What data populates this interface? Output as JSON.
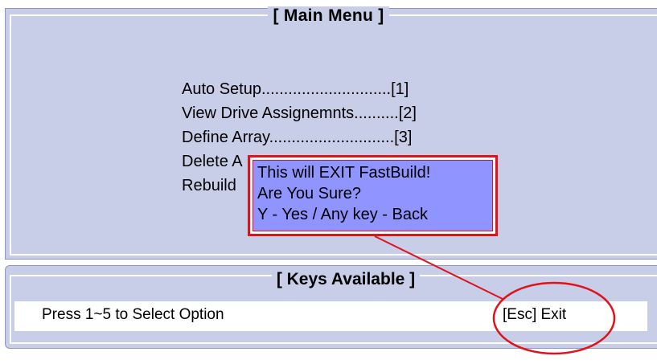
{
  "main_menu": {
    "title": "[ Main Menu ]",
    "items": [
      "Auto Setup.............................[1]",
      "View Drive Assignemnts..........[2]",
      "Define Array............................[3]",
      "Delete A",
      "Rebuild"
    ]
  },
  "dialog": {
    "line1": "This will EXIT FastBuild!",
    "line2": "Are You Sure?",
    "line3": "Y - Yes / Any key - Back"
  },
  "keys_available": {
    "title": "[ Keys Available ]",
    "left_hint": "Press 1~5 to Select Option",
    "right_hint": "[Esc] Exit"
  },
  "colors": {
    "panel_background": "#c8cde8",
    "dialog_background": "#9094ff",
    "dialog_border": "#e0121a",
    "annotation": "#e0121a"
  }
}
